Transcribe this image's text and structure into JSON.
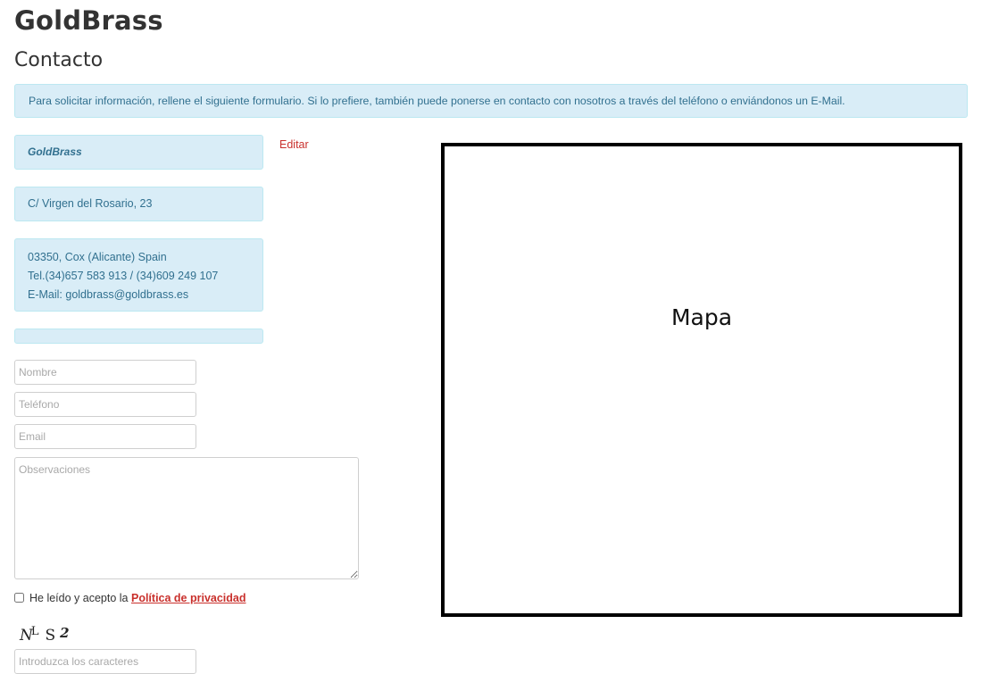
{
  "site": {
    "title": "GoldBrass"
  },
  "page": {
    "title": "Contacto"
  },
  "intro": {
    "text": "Para solicitar información, rellene el siguiente formulario. Si lo prefiere, también puede ponerse en contacto con nosotros a través del teléfono o enviándonos un E-Mail."
  },
  "contact": {
    "company": "GoldBrass",
    "street": "C/ Virgen del Rosario, 23",
    "city": "03350, Cox (Alicante) Spain",
    "phone": "Tel.(34)657 583 913 / (34)609 249 107",
    "email": "E-Mail: goldbrass@goldbrass.es",
    "edit_label": "Editar"
  },
  "form": {
    "name_placeholder": "Nombre",
    "phone_placeholder": "Teléfono",
    "email_placeholder": "Email",
    "notes_placeholder": "Observaciones",
    "consent_text": "He leído y acepto la",
    "policy_link": "Política de privacidad",
    "captcha_chars": [
      "N",
      "L",
      "S",
      "2"
    ],
    "captcha_placeholder": "Introduzca los caracteres"
  },
  "map": {
    "label": "Mapa"
  },
  "colors": {
    "info_bg": "#d9edf7",
    "info_text": "#31708f",
    "link_red": "#c9302c"
  }
}
